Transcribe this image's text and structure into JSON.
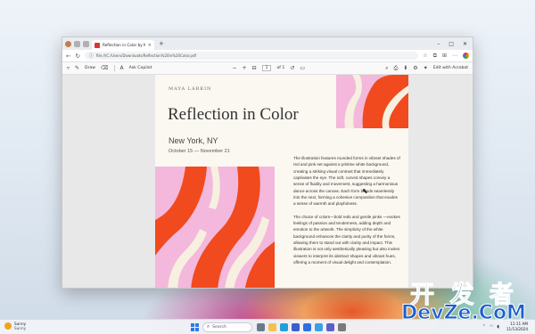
{
  "browser": {
    "tab_title": "Reflection in Color by Maya Lark...",
    "url": "file:///C:/Users/Downloads/Reflection%20in%20Color.pdf"
  },
  "pdf_toolbar": {
    "draw_label": "Draw",
    "ask_copilot_label": "Ask Copilot",
    "zoom_minus": "−",
    "zoom_plus": "+",
    "page_current": "1",
    "page_total": "of 1",
    "edit_acrobat_label": "Edit with Acrobat"
  },
  "document": {
    "author": "MAYA LARKIN",
    "title": "Reflection in Color",
    "city": "New York, NY",
    "dates": "October 15 — November 21",
    "paragraphs": [
      "The illustration features rounded forms in vibrant shades of red and pink set against a pristine white background, creating a striking visual contrast that immediately captivates the eye. The soft, curved shapes convey a sense of fluidity and movement, suggesting a harmonious dance across the canvas. Each form blends seamlessly into the next, forming a cohesive composition that exudes a sense of warmth and playfulness.",
      "The choice of colors—bold reds and gentle pinks —evokes feelings of passion and tenderness, adding depth and emotion to the artwork. The simplicity of the white background enhances the clarity and purity of the forms, allowing them to stand out with clarity and impact. This illustration is not only aesthetically pleasing but also invites viewers to interpret its abstract shapes and vibrant hues, offering a moment of visual delight and contemplation."
    ]
  },
  "taskbar": {
    "weather_temp": "Sunny",
    "weather_desc": "Sunny",
    "search_placeholder": "Search",
    "time": "11:11 AM",
    "date": "11/13/2024"
  },
  "watermark": {
    "line1": "开 发 者",
    "line2": "DevZe.CoM"
  },
  "colors": {
    "art_red": "#f04a1e",
    "art_pink": "#f3b8dc",
    "art_cream": "#f7efe0"
  }
}
